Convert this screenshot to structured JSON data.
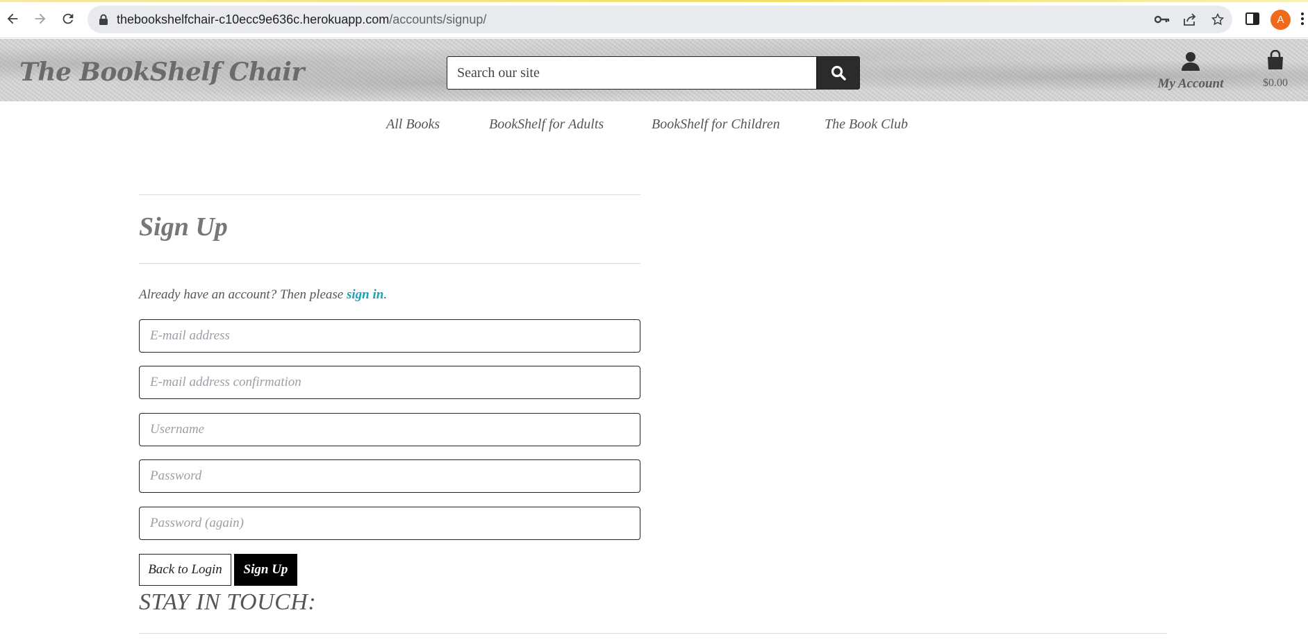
{
  "browser": {
    "url_host": "thebookshelfchair-c10ecc9e636c.herokuapp.com",
    "url_path": "/accounts/signup/",
    "profile_initial": "A",
    "icons": {
      "back": "arrow-left-icon",
      "forward": "arrow-right-icon",
      "reload": "reload-icon",
      "lock": "lock-icon",
      "key": "key-icon",
      "share": "share-icon",
      "bookmark": "star-icon",
      "side_panel": "side-panel-icon",
      "menu": "kebab-menu-icon"
    }
  },
  "header": {
    "logo": "The BookShelf Chair",
    "search_placeholder": "Search our site",
    "account_label": "My Account",
    "bag_total": "$0.00"
  },
  "nav": {
    "items": [
      {
        "label": "All Books"
      },
      {
        "label": "BookShelf for Adults"
      },
      {
        "label": "BookShelf for Children"
      },
      {
        "label": "The Book Club"
      }
    ]
  },
  "signup": {
    "title": "Sign Up",
    "already_text": "Already have an account? Then please ",
    "signin_link": "sign in",
    "period": ".",
    "fields": {
      "email": "E-mail address",
      "email_confirm": "E-mail address confirmation",
      "username": "Username",
      "password": "Password",
      "password_again": "Password (again)"
    },
    "back_button": "Back to Login",
    "submit_button": "Sign Up"
  },
  "footer": {
    "stay_in_touch": "STAY IN TOUCH:"
  },
  "colors": {
    "link": "#17a2b8",
    "dark_button": "#000000",
    "search_button": "#2b2b2b",
    "profile": "#f06a1b"
  }
}
